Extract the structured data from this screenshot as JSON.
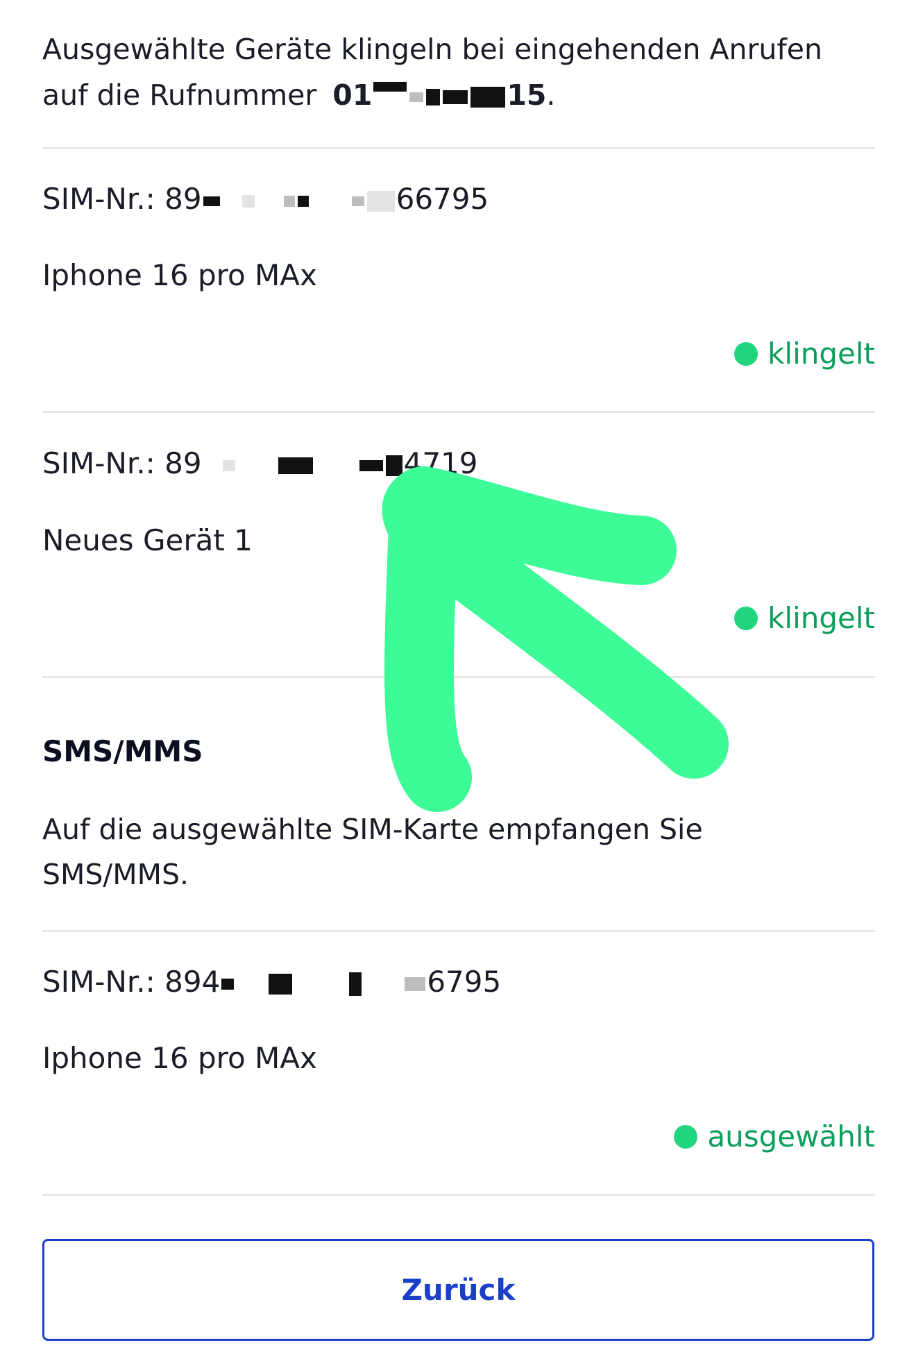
{
  "calls": {
    "intro_text": "Ausgewählte Geräte klingeln bei eingehenden Anrufen auf die Rufnummer",
    "number_prefix": "01",
    "number_suffix": "15",
    "number_end": "."
  },
  "call_devices": [
    {
      "sim_label": "SIM-Nr.:",
      "sim_prefix": "89",
      "sim_suffix": "66795",
      "device_name": "Iphone 16 pro MAx",
      "status": "klingelt"
    },
    {
      "sim_label": "SIM-Nr.:",
      "sim_prefix": "89",
      "sim_suffix": "4719",
      "device_name": "Neues Gerät 1",
      "status": "klingelt"
    }
  ],
  "sms": {
    "title": "SMS/MMS",
    "text": "Auf die ausgewählte SIM-Karte empfangen Sie SMS/MMS.",
    "device": {
      "sim_label": "SIM-Nr.:",
      "sim_prefix": "894",
      "sim_suffix": "6795",
      "device_name": "Iphone 16 pro MAx",
      "status": "ausgewählt"
    }
  },
  "back_button_label": "Zurück",
  "colors": {
    "status_green": "#0a9e5a",
    "dot_green": "#1fd67e",
    "button_blue": "#1b3fc7",
    "arrow_green": "#3dfc98"
  }
}
